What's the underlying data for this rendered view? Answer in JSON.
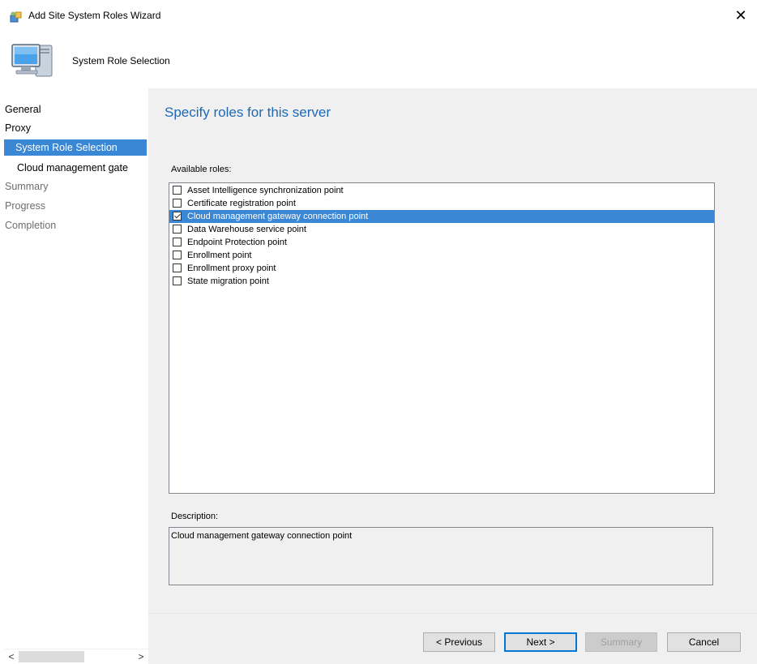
{
  "window": {
    "title": "Add Site System Roles Wizard",
    "close_glyph": "✕"
  },
  "header": {
    "title": "System Role Selection"
  },
  "nav": {
    "items": [
      {
        "label": "General",
        "state": "normal"
      },
      {
        "label": "Proxy",
        "state": "normal"
      },
      {
        "label": "System Role Selection",
        "state": "selected"
      },
      {
        "label": "Cloud management gate",
        "state": "sub"
      },
      {
        "label": "Summary",
        "state": "disabled"
      },
      {
        "label": "Progress",
        "state": "disabled"
      },
      {
        "label": "Completion",
        "state": "disabled"
      }
    ],
    "scroll_left": "<",
    "scroll_right": ">"
  },
  "main": {
    "heading": "Specify roles for this server",
    "available_label": "Available roles:",
    "roles": [
      {
        "label": "Asset Intelligence synchronization point",
        "checked": false,
        "selected": false
      },
      {
        "label": "Certificate registration point",
        "checked": false,
        "selected": false
      },
      {
        "label": "Cloud management gateway connection point",
        "checked": true,
        "selected": true
      },
      {
        "label": "Data Warehouse service point",
        "checked": false,
        "selected": false
      },
      {
        "label": "Endpoint Protection point",
        "checked": false,
        "selected": false
      },
      {
        "label": "Enrollment point",
        "checked": false,
        "selected": false
      },
      {
        "label": "Enrollment proxy point",
        "checked": false,
        "selected": false
      },
      {
        "label": "State migration point",
        "checked": false,
        "selected": false
      }
    ],
    "description_label": "Description:",
    "description_text": "Cloud management gateway connection point"
  },
  "buttons": {
    "previous": "< Previous",
    "next": "Next >",
    "summary": "Summary",
    "cancel": "Cancel"
  },
  "colors": {
    "selection": "#3a87d6",
    "heading": "#1d69b8",
    "panel": "#f0f0f0"
  }
}
